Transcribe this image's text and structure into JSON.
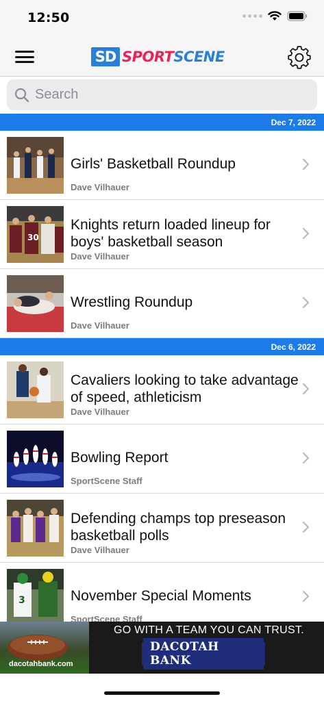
{
  "status_bar": {
    "time": "12:50"
  },
  "header": {
    "logo_sd": "SD",
    "logo_sport": "SPORT",
    "logo_scene": "SCENE"
  },
  "search": {
    "placeholder": "Search"
  },
  "sections": [
    {
      "date": "Dec 7, 2022",
      "articles": [
        {
          "title": "Girls' Basketball Roundup",
          "author": "Dave Vilhauer"
        },
        {
          "title": "Knights return loaded lineup for boys' basketball season",
          "author": "Dave Vilhauer"
        },
        {
          "title": "Wrestling Roundup",
          "author": "Dave Vilhauer"
        }
      ]
    },
    {
      "date": "Dec 6, 2022",
      "articles": [
        {
          "title": "Cavaliers looking to take advantage of speed, athleticism",
          "author": "Dave Vilhauer"
        },
        {
          "title": "Bowling Report",
          "author": "SportScene Staff"
        },
        {
          "title": "Defending champs top preseason basketball polls",
          "author": "Dave Vilhauer"
        },
        {
          "title": "November Special Moments",
          "author": "SportScene Staff"
        }
      ]
    }
  ],
  "ad": {
    "tagline": "GO WITH A TEAM YOU CAN TRUST.",
    "bank_name": "DACOTAH BANK",
    "domain": "dacotahbank.com"
  },
  "colors": {
    "accent_blue": "#1e7ce8",
    "brand_pink": "#e8235a",
    "brand_blue": "#2a7fd6"
  }
}
